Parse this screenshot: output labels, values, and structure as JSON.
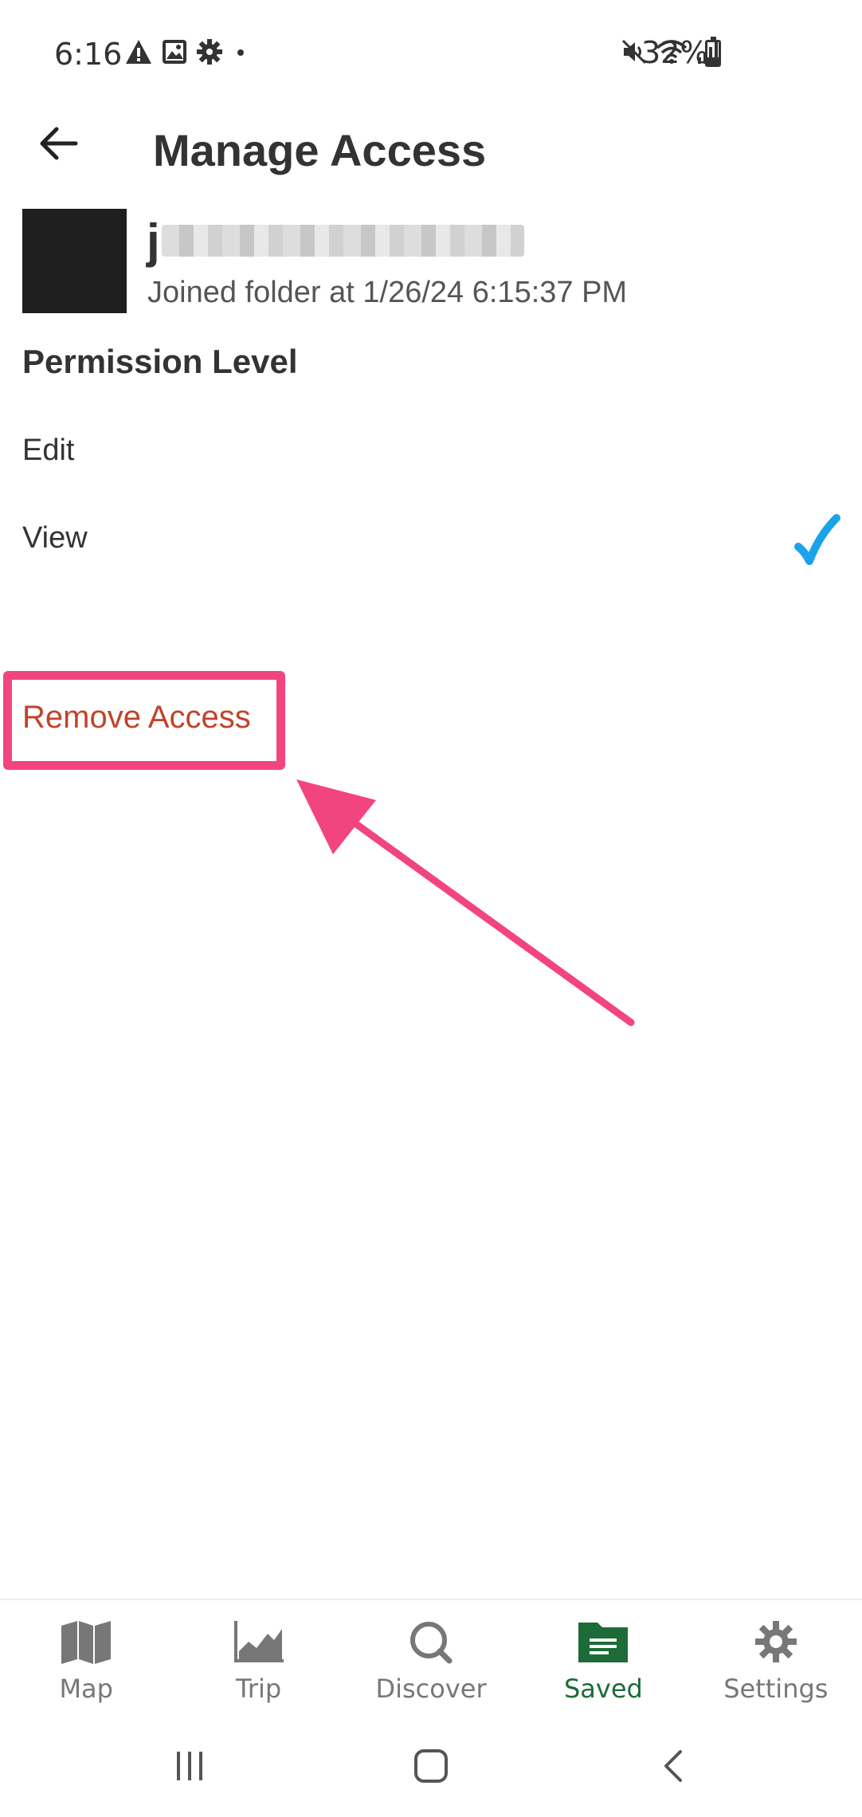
{
  "status_bar": {
    "time": "6:16",
    "battery_text": "32%",
    "battery_level": 0.32,
    "left_icons": [
      "warning-icon",
      "image-icon",
      "gear-icon",
      "dot-icon"
    ],
    "right_icons": [
      "mute-icon",
      "wifi-icon",
      "signal-icon",
      "battery-icon"
    ]
  },
  "header": {
    "title": "Manage Access",
    "back_icon": "arrow-left-icon"
  },
  "user": {
    "name_visible": "j",
    "joined_text": "Joined folder at 1/26/24 6:15:37 PM"
  },
  "permissions": {
    "heading": "Permission Level",
    "options": [
      {
        "label": "Edit",
        "selected": false
      },
      {
        "label": "View",
        "selected": true
      }
    ],
    "check_color": "#1aa3e8"
  },
  "remove_access": {
    "label": "Remove Access",
    "color": "#c0442a"
  },
  "annotation": {
    "highlight_color": "#f2457f"
  },
  "bottom_nav": {
    "items": [
      {
        "label": "Map",
        "icon": "map-icon",
        "active": false
      },
      {
        "label": "Trip",
        "icon": "chart-icon",
        "active": false
      },
      {
        "label": "Discover",
        "icon": "search-icon",
        "active": false
      },
      {
        "label": "Saved",
        "icon": "folder-icon",
        "active": true
      },
      {
        "label": "Settings",
        "icon": "gear-icon",
        "active": false
      }
    ],
    "active_color": "#1d6b37",
    "inactive_color": "#777777"
  },
  "system_nav": {
    "buttons": [
      "recents-icon",
      "home-icon",
      "back-icon"
    ]
  }
}
